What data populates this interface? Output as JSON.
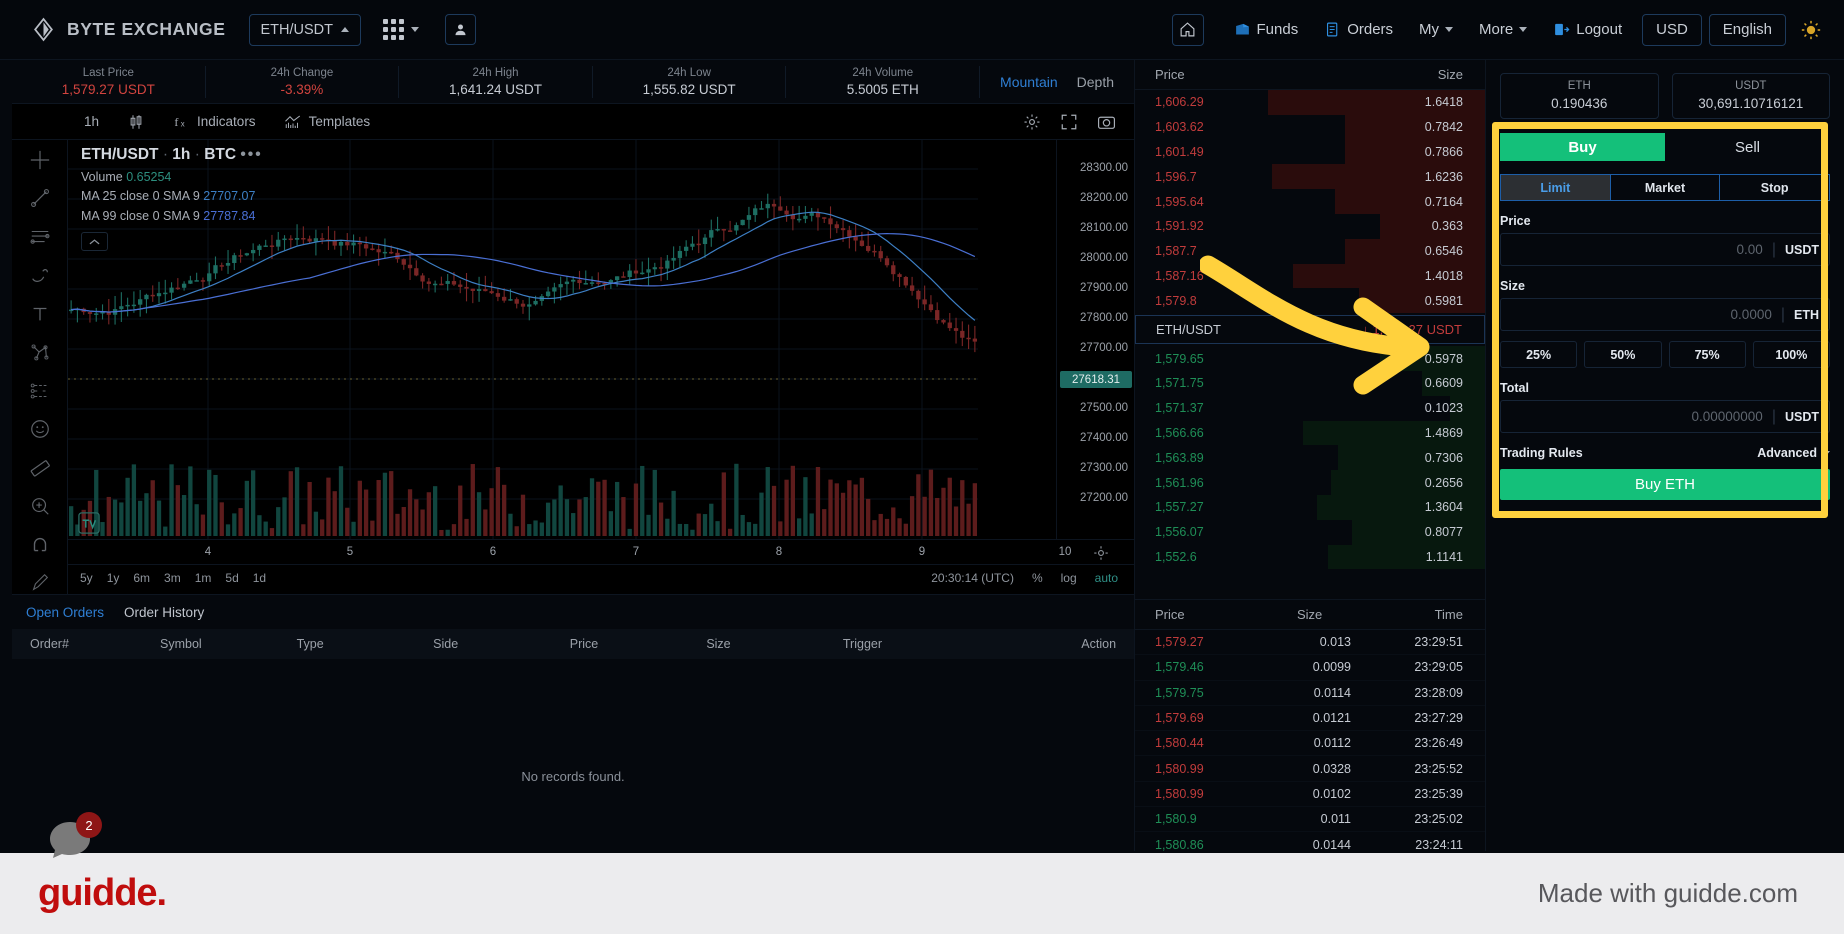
{
  "header": {
    "brand": "BYTE EXCHANGE",
    "pair": "ETH/USDT",
    "nav": [
      {
        "label": "Funds",
        "icon": "funds-icon"
      },
      {
        "label": "Orders",
        "icon": "orders-icon"
      },
      {
        "label": "My",
        "icon": "chevron-down-icon"
      },
      {
        "label": "More",
        "icon": "chevron-down-icon"
      },
      {
        "label": "Logout",
        "icon": "logout-icon"
      }
    ],
    "currency": "USD",
    "language": "English"
  },
  "stats": [
    {
      "label": "Last Price",
      "value": "1,579.27 USDT",
      "tone": "red"
    },
    {
      "label": "24h Change",
      "value": "-3.39%",
      "tone": "red"
    },
    {
      "label": "24h High",
      "value": "1,641.24 USDT",
      "tone": "neutral"
    },
    {
      "label": "24h Low",
      "value": "1,555.82 USDT",
      "tone": "neutral"
    },
    {
      "label": "24h Volume",
      "value": "5.5005 ETH",
      "tone": "neutral"
    }
  ],
  "view_toggle": {
    "mountain": "Mountain",
    "depth": "Depth"
  },
  "chart": {
    "toolbar": {
      "interval": "1h",
      "candles": "candles-icon",
      "indicators": "Indicators",
      "templates": "Templates"
    },
    "legend": {
      "symbol": "ETH/USDT",
      "interval": "1h",
      "exchange": "BTC",
      "more": "•••",
      "volume_label": "Volume",
      "volume_value": "0.65254",
      "ma25_label": "MA 25 close 0 SMA 9",
      "ma25_value": "27707.07",
      "ma99_label": "MA 99 close 0 SMA 9",
      "ma99_value": "27787.84"
    },
    "price_ticks": [
      "28300.00",
      "28200.00",
      "28100.00",
      "28000.00",
      "27900.00",
      "27800.00",
      "27700.00",
      "27500.00",
      "27400.00",
      "27300.00",
      "27200.00"
    ],
    "current_price_tag": "27618.31",
    "time_ticks": [
      "4",
      "5",
      "6",
      "7",
      "8",
      "9",
      "10"
    ],
    "ranges": [
      "5y",
      "1y",
      "6m",
      "3m",
      "1m",
      "5d",
      "1d"
    ],
    "clock": "20:30:14 (UTC)",
    "scale_opts": [
      "%",
      "log",
      "auto"
    ]
  },
  "orders": {
    "tabs": [
      {
        "label": "Open Orders",
        "active": true
      },
      {
        "label": "Order History",
        "active": false
      }
    ],
    "columns": [
      "Order#",
      "Symbol",
      "Type",
      "Side",
      "Price",
      "Size",
      "Trigger",
      "Action"
    ],
    "empty": "No records found."
  },
  "orderbook": {
    "columns": {
      "price": "Price",
      "size": "Size"
    },
    "asks": [
      {
        "price": "1,606.29",
        "size": "1.6418",
        "depth": 62
      },
      {
        "price": "1,603.62",
        "size": "0.7842",
        "depth": 40
      },
      {
        "price": "1,601.49",
        "size": "0.7866",
        "depth": 40
      },
      {
        "price": "1,596.7",
        "size": "1.6236",
        "depth": 61
      },
      {
        "price": "1,595.64",
        "size": "0.7164",
        "depth": 43
      },
      {
        "price": "1,591.92",
        "size": "0.363",
        "depth": 30
      },
      {
        "price": "1,587.7",
        "size": "0.6546",
        "depth": 40
      },
      {
        "price": "1,587.16",
        "size": "1.4018",
        "depth": 55
      },
      {
        "price": "1,579.8",
        "size": "0.5981",
        "depth": 36
      }
    ],
    "spread": {
      "symbol": "ETH/USDT",
      "arrow": "↓",
      "price": "1,579.27 USDT"
    },
    "bids": [
      {
        "price": "1,579.65",
        "size": "0.5978",
        "depth": 30
      },
      {
        "price": "1,571.75",
        "size": "0.6609",
        "depth": 18
      },
      {
        "price": "1,571.37",
        "size": "0.1023",
        "depth": 10
      },
      {
        "price": "1,566.66",
        "size": "1.4869",
        "depth": 52
      },
      {
        "price": "1,563.89",
        "size": "0.7306",
        "depth": 42
      },
      {
        "price": "1,561.96",
        "size": "0.2656",
        "depth": 44
      },
      {
        "price": "1,557.27",
        "size": "1.3604",
        "depth": 48
      },
      {
        "price": "1,556.07",
        "size": "0.8077",
        "depth": 38
      },
      {
        "price": "1,552.6",
        "size": "1.1141",
        "depth": 45
      }
    ]
  },
  "trades": {
    "columns": [
      "Price",
      "Size",
      "Time"
    ],
    "rows": [
      {
        "price": "1,579.27",
        "size": "0.013",
        "time": "23:29:51",
        "dir": "down"
      },
      {
        "price": "1,579.46",
        "size": "0.0099",
        "time": "23:29:05",
        "dir": "up"
      },
      {
        "price": "1,579.75",
        "size": "0.0114",
        "time": "23:28:09",
        "dir": "up"
      },
      {
        "price": "1,579.69",
        "size": "0.0121",
        "time": "23:27:29",
        "dir": "down"
      },
      {
        "price": "1,580.44",
        "size": "0.0112",
        "time": "23:26:49",
        "dir": "down"
      },
      {
        "price": "1,580.99",
        "size": "0.0328",
        "time": "23:25:52",
        "dir": "down"
      },
      {
        "price": "1,580.99",
        "size": "0.0102",
        "time": "23:25:39",
        "dir": "down"
      },
      {
        "price": "1,580.9",
        "size": "0.011",
        "time": "23:25:02",
        "dir": "up"
      },
      {
        "price": "1,580.86",
        "size": "0.0144",
        "time": "23:24:11",
        "dir": "up"
      }
    ]
  },
  "form": {
    "balances": [
      {
        "currency": "ETH",
        "amount": "0.190436"
      },
      {
        "currency": "USDT",
        "amount": "30,691.10716121"
      }
    ],
    "side_tabs": [
      {
        "label": "Buy",
        "active": true
      },
      {
        "label": "Sell",
        "active": false
      }
    ],
    "type_tabs": [
      {
        "label": "Limit",
        "active": true
      },
      {
        "label": "Market",
        "active": false
      },
      {
        "label": "Stop",
        "active": false
      }
    ],
    "price": {
      "label": "Price",
      "placeholder": "0.00",
      "unit": "USDT"
    },
    "size": {
      "label": "Size",
      "placeholder": "0.0000",
      "unit": "ETH"
    },
    "percents": [
      "25%",
      "50%",
      "75%",
      "100%"
    ],
    "total": {
      "label": "Total",
      "placeholder": "0.00000000",
      "unit": "USDT"
    },
    "rules": {
      "label": "Trading Rules",
      "advanced": "Advanced"
    },
    "submit": "Buy ETH"
  },
  "chat": {
    "badge": "2"
  },
  "guidde": {
    "logo": "guidde.",
    "made": "Made with guidde.com"
  },
  "colors": {
    "buy": "#14c07a",
    "sell": "#c23c3c",
    "accent": "#2f7fd4",
    "highlight": "#ffd13d"
  }
}
